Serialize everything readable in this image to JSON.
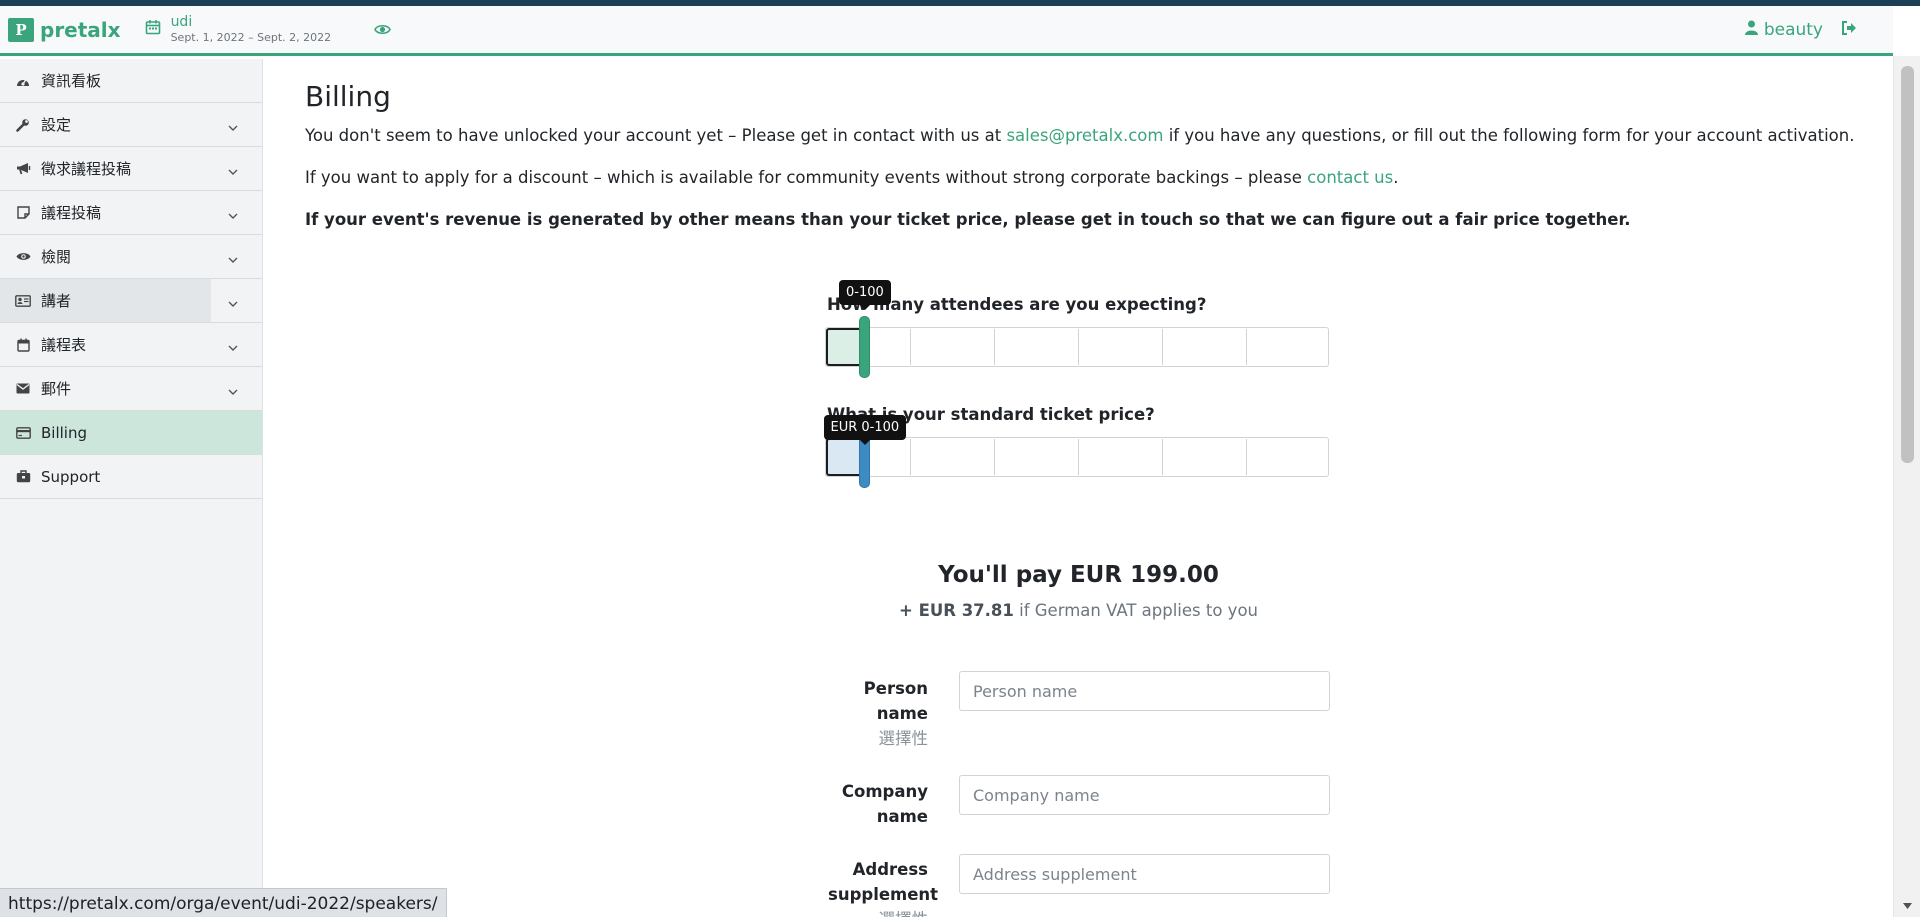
{
  "brand": {
    "logo_letter": "P",
    "name": "pretalx",
    "color": "#3aa57c"
  },
  "event": {
    "name": "udi",
    "dates": "Sept. 1, 2022 – Sept. 2, 2022"
  },
  "user": {
    "name": "beauty"
  },
  "sidebar": {
    "items": [
      {
        "label": "資訊看板",
        "icon": "dashboard-icon",
        "has_chevron": false
      },
      {
        "label": "設定",
        "icon": "wrench-icon",
        "has_chevron": true
      },
      {
        "label": "徵求議程投稿",
        "icon": "bullhorn-icon",
        "has_chevron": true
      },
      {
        "label": "議程投稿",
        "icon": "sticky-note-icon",
        "has_chevron": true
      },
      {
        "label": "檢閱",
        "icon": "eye-icon",
        "has_chevron": true
      },
      {
        "label": "講者",
        "icon": "id-card-icon",
        "has_chevron": true
      },
      {
        "label": "議程表",
        "icon": "calendar-icon",
        "has_chevron": true
      },
      {
        "label": "郵件",
        "icon": "envelope-icon",
        "has_chevron": true
      },
      {
        "label": "Billing",
        "icon": "credit-card-icon",
        "has_chevron": false
      },
      {
        "label": "Support",
        "icon": "briefcase-icon",
        "has_chevron": false
      }
    ]
  },
  "main": {
    "title": "Billing",
    "p1_before": "You don't seem to have unlocked your account yet – Please get in contact with us at ",
    "p1_link": "sales@pretalx.com",
    "p1_after": " if you have any questions, or fill out the following form for your account activation.",
    "p2_before": "If you want to apply for a discount – which is available for community events without strong corporate backings – please ",
    "p2_link": "contact us",
    "p2_after": ".",
    "p3": "If your event's revenue is generated by other means than your ticket price, please get in touch so that we can figure out a fair price together."
  },
  "attendees": {
    "question": "How many attendees are you expecting?",
    "tooltip": "0-100",
    "level_percent": 8,
    "fill_color": "#dcefe7",
    "handle_color": "#3aa57c"
  },
  "ticket": {
    "question": "What is your standard ticket price?",
    "tooltip": "EUR 0-100",
    "level_percent": 8,
    "fill_color": "#d9e8f3",
    "handle_color": "#3e8ac2"
  },
  "price": {
    "pay": "You'll pay EUR 199.00",
    "vat_amount": "+ EUR 37.81",
    "vat_text": " if German VAT applies to you"
  },
  "form": {
    "person_label": "Person name",
    "person_optional": "選擇性",
    "person_placeholder": "Person name",
    "company_label": "Company name",
    "company_placeholder": "Company name",
    "address_label": "Address supplement",
    "address_optional": "選擇性",
    "address_placeholder": "Address supplement"
  },
  "status_url": "https://pretalx.com/orga/event/udi-2022/speakers/"
}
